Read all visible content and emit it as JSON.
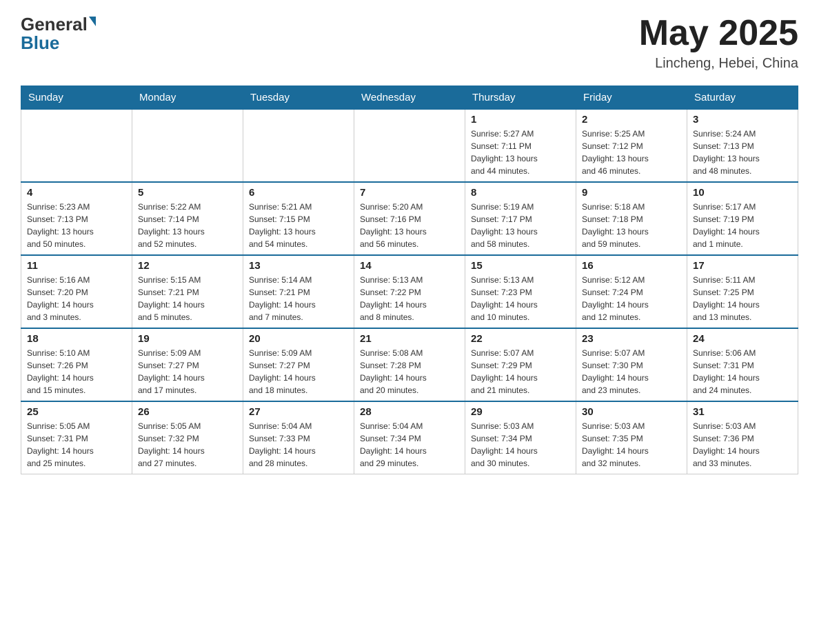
{
  "header": {
    "logo_general": "General",
    "logo_blue": "Blue",
    "month_title": "May 2025",
    "location": "Lincheng, Hebei, China"
  },
  "days_of_week": [
    "Sunday",
    "Monday",
    "Tuesday",
    "Wednesday",
    "Thursday",
    "Friday",
    "Saturday"
  ],
  "weeks": [
    [
      {
        "day": "",
        "info": ""
      },
      {
        "day": "",
        "info": ""
      },
      {
        "day": "",
        "info": ""
      },
      {
        "day": "",
        "info": ""
      },
      {
        "day": "1",
        "info": "Sunrise: 5:27 AM\nSunset: 7:11 PM\nDaylight: 13 hours\nand 44 minutes."
      },
      {
        "day": "2",
        "info": "Sunrise: 5:25 AM\nSunset: 7:12 PM\nDaylight: 13 hours\nand 46 minutes."
      },
      {
        "day": "3",
        "info": "Sunrise: 5:24 AM\nSunset: 7:13 PM\nDaylight: 13 hours\nand 48 minutes."
      }
    ],
    [
      {
        "day": "4",
        "info": "Sunrise: 5:23 AM\nSunset: 7:13 PM\nDaylight: 13 hours\nand 50 minutes."
      },
      {
        "day": "5",
        "info": "Sunrise: 5:22 AM\nSunset: 7:14 PM\nDaylight: 13 hours\nand 52 minutes."
      },
      {
        "day": "6",
        "info": "Sunrise: 5:21 AM\nSunset: 7:15 PM\nDaylight: 13 hours\nand 54 minutes."
      },
      {
        "day": "7",
        "info": "Sunrise: 5:20 AM\nSunset: 7:16 PM\nDaylight: 13 hours\nand 56 minutes."
      },
      {
        "day": "8",
        "info": "Sunrise: 5:19 AM\nSunset: 7:17 PM\nDaylight: 13 hours\nand 58 minutes."
      },
      {
        "day": "9",
        "info": "Sunrise: 5:18 AM\nSunset: 7:18 PM\nDaylight: 13 hours\nand 59 minutes."
      },
      {
        "day": "10",
        "info": "Sunrise: 5:17 AM\nSunset: 7:19 PM\nDaylight: 14 hours\nand 1 minute."
      }
    ],
    [
      {
        "day": "11",
        "info": "Sunrise: 5:16 AM\nSunset: 7:20 PM\nDaylight: 14 hours\nand 3 minutes."
      },
      {
        "day": "12",
        "info": "Sunrise: 5:15 AM\nSunset: 7:21 PM\nDaylight: 14 hours\nand 5 minutes."
      },
      {
        "day": "13",
        "info": "Sunrise: 5:14 AM\nSunset: 7:21 PM\nDaylight: 14 hours\nand 7 minutes."
      },
      {
        "day": "14",
        "info": "Sunrise: 5:13 AM\nSunset: 7:22 PM\nDaylight: 14 hours\nand 8 minutes."
      },
      {
        "day": "15",
        "info": "Sunrise: 5:13 AM\nSunset: 7:23 PM\nDaylight: 14 hours\nand 10 minutes."
      },
      {
        "day": "16",
        "info": "Sunrise: 5:12 AM\nSunset: 7:24 PM\nDaylight: 14 hours\nand 12 minutes."
      },
      {
        "day": "17",
        "info": "Sunrise: 5:11 AM\nSunset: 7:25 PM\nDaylight: 14 hours\nand 13 minutes."
      }
    ],
    [
      {
        "day": "18",
        "info": "Sunrise: 5:10 AM\nSunset: 7:26 PM\nDaylight: 14 hours\nand 15 minutes."
      },
      {
        "day": "19",
        "info": "Sunrise: 5:09 AM\nSunset: 7:27 PM\nDaylight: 14 hours\nand 17 minutes."
      },
      {
        "day": "20",
        "info": "Sunrise: 5:09 AM\nSunset: 7:27 PM\nDaylight: 14 hours\nand 18 minutes."
      },
      {
        "day": "21",
        "info": "Sunrise: 5:08 AM\nSunset: 7:28 PM\nDaylight: 14 hours\nand 20 minutes."
      },
      {
        "day": "22",
        "info": "Sunrise: 5:07 AM\nSunset: 7:29 PM\nDaylight: 14 hours\nand 21 minutes."
      },
      {
        "day": "23",
        "info": "Sunrise: 5:07 AM\nSunset: 7:30 PM\nDaylight: 14 hours\nand 23 minutes."
      },
      {
        "day": "24",
        "info": "Sunrise: 5:06 AM\nSunset: 7:31 PM\nDaylight: 14 hours\nand 24 minutes."
      }
    ],
    [
      {
        "day": "25",
        "info": "Sunrise: 5:05 AM\nSunset: 7:31 PM\nDaylight: 14 hours\nand 25 minutes."
      },
      {
        "day": "26",
        "info": "Sunrise: 5:05 AM\nSunset: 7:32 PM\nDaylight: 14 hours\nand 27 minutes."
      },
      {
        "day": "27",
        "info": "Sunrise: 5:04 AM\nSunset: 7:33 PM\nDaylight: 14 hours\nand 28 minutes."
      },
      {
        "day": "28",
        "info": "Sunrise: 5:04 AM\nSunset: 7:34 PM\nDaylight: 14 hours\nand 29 minutes."
      },
      {
        "day": "29",
        "info": "Sunrise: 5:03 AM\nSunset: 7:34 PM\nDaylight: 14 hours\nand 30 minutes."
      },
      {
        "day": "30",
        "info": "Sunrise: 5:03 AM\nSunset: 7:35 PM\nDaylight: 14 hours\nand 32 minutes."
      },
      {
        "day": "31",
        "info": "Sunrise: 5:03 AM\nSunset: 7:36 PM\nDaylight: 14 hours\nand 33 minutes."
      }
    ]
  ]
}
